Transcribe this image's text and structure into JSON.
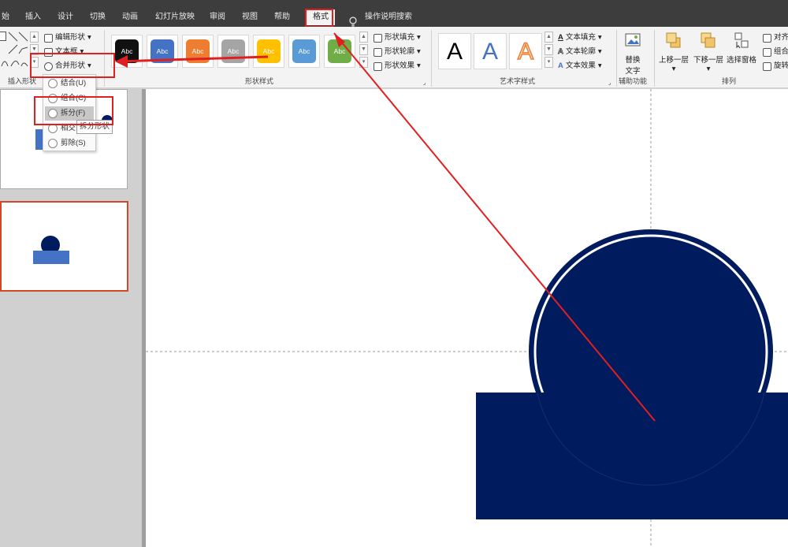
{
  "menu_tabs": [
    "始",
    "插入",
    "设计",
    "切换",
    "动画",
    "幻灯片放映",
    "审阅",
    "视图",
    "帮助",
    "格式",
    "操作说明搜索"
  ],
  "ribbon": {
    "insert_shapes": {
      "edit_shape": "编辑形状",
      "text_box": "文本框",
      "merge_shapes": "合并形状",
      "group_label": "插入形状"
    },
    "shape_styles": {
      "swatch_text": "Abc",
      "swatches": [
        "#111111",
        "#4472c4",
        "#ed7d31",
        "#a5a5a5",
        "#ffc000",
        "#5b9bd5",
        "#70ad47"
      ],
      "shape_fill": "形状填充",
      "shape_outline": "形状轮廓",
      "shape_effects": "形状效果",
      "group_label": "形状样式"
    },
    "wordart": {
      "letters": [
        "A",
        "A",
        "A"
      ],
      "text_fill": "文本填充",
      "text_outline": "文本轮廓",
      "text_effects": "文本效果",
      "group_label": "艺术字样式"
    },
    "accessibility": {
      "alt_text_line1": "替换",
      "alt_text_line2": "文字",
      "group_label": "辅助功能"
    },
    "arrange": {
      "bring_forward": "上移一层",
      "send_backward": "下移一层",
      "selection_pane": "选择窗格",
      "align": "对齐",
      "group": "组合",
      "rotate": "旋转",
      "group_label": "排列"
    }
  },
  "merge_dropdown": {
    "items": [
      "结合(U)",
      "组合(C)",
      "拆分(F)",
      "相交",
      "剪除(S)"
    ],
    "tooltip": "拆分形状"
  },
  "colors": {
    "navy": "#001b5e",
    "highlight_red": "#e02020",
    "thumb_blue": "#4472c4"
  }
}
